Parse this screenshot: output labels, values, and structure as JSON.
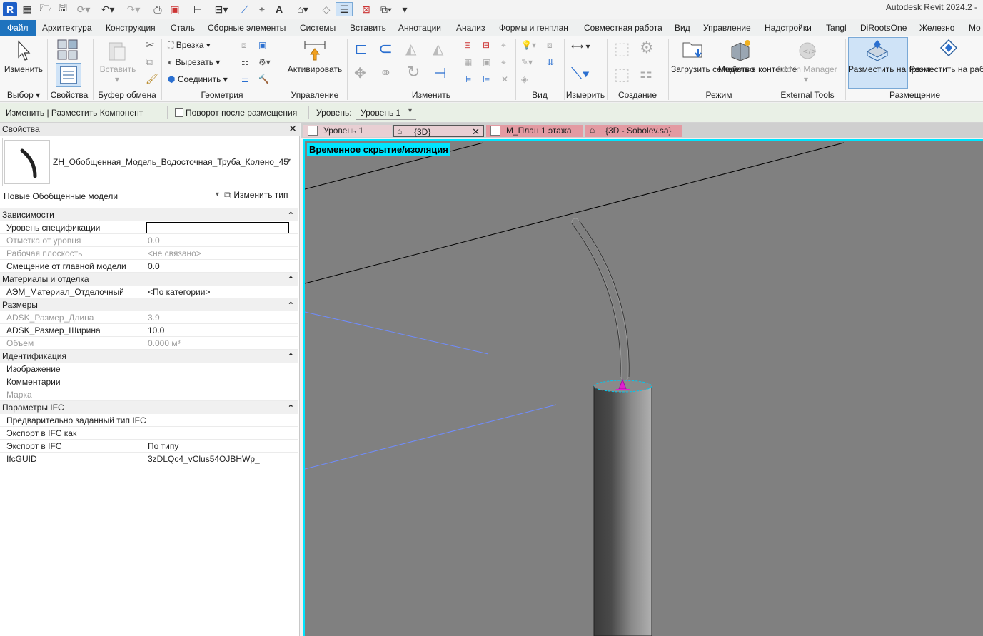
{
  "app": {
    "title": "Autodesk Revit 2024.2 -"
  },
  "menu_tabs": [
    "Файл",
    "Архитектура",
    "Конструкция",
    "Сталь",
    "Сборные элементы",
    "Системы",
    "Вставить",
    "Аннотации",
    "Анализ",
    "Формы и генплан",
    "Совместная работа",
    "Вид",
    "Управление",
    "Надстройки",
    "Tangl",
    "DiRootsOne",
    "Железно",
    "Mo"
  ],
  "ribbon": {
    "modify_label": "Изменить",
    "paste_label": "Вставить",
    "cut_label": "Врезка",
    "cutout_label": "Вырезать",
    "join_label": "Соединить",
    "activate_label": "Активировать",
    "load_family_label": "Загрузить семейство",
    "model_in_context_label": "Модель в контексте",
    "addin_manager_label": "Add-in Manager",
    "place_on_face_label": "Разместить на грани",
    "place_on_plane_label": "Разместить на рабочей плоскост",
    "panels": {
      "select": "Выбор",
      "properties": "Свойства",
      "clipboard": "Буфер обмена",
      "geometry": "Геометрия",
      "control": "Управление",
      "modify": "Изменить",
      "view": "Вид",
      "measure": "Измерить",
      "create": "Создание",
      "mode": "Режим",
      "external_tools": "External Tools",
      "placement": "Размещение"
    }
  },
  "options_bar": {
    "context": "Изменить | Разместить Компонент",
    "rotate_after_place": "Поворот после размещения",
    "level_label": "Уровень:",
    "level_value": "Уровень 1"
  },
  "properties": {
    "title": "Свойства",
    "family_name": "ZH_Обобщенная_Модель_Водосточная_Труба_Колено_45",
    "instance_filter": "Новые Обобщенные модели",
    "edit_type": "Изменить тип",
    "groups": [
      {
        "name": "Зависимости",
        "rows": [
          {
            "name": "Уровень спецификации",
            "value": "",
            "disabled": false,
            "editing": true
          },
          {
            "name": "Отметка от уровня",
            "value": "0.0",
            "disabled": true
          },
          {
            "name": "Рабочая плоскость",
            "value": "<не связано>",
            "disabled": true
          },
          {
            "name": "Смещение от главной модели",
            "value": "0.0",
            "disabled": false
          }
        ]
      },
      {
        "name": "Материалы и отделка",
        "rows": [
          {
            "name": "АЭМ_Материал_Отделочный",
            "value": "<По категории>",
            "disabled": false
          }
        ]
      },
      {
        "name": "Размеры",
        "rows": [
          {
            "name": "ADSK_Размер_Длина",
            "value": "3.9",
            "disabled": true
          },
          {
            "name": "ADSK_Размер_Ширина",
            "value": "10.0",
            "disabled": false
          },
          {
            "name": "Объем",
            "value": "0.000 м³",
            "disabled": true
          }
        ]
      },
      {
        "name": "Идентификация",
        "rows": [
          {
            "name": "Изображение",
            "value": "",
            "disabled": false
          },
          {
            "name": "Комментарии",
            "value": "",
            "disabled": false
          },
          {
            "name": "Марка",
            "value": "",
            "disabled": true
          }
        ]
      },
      {
        "name": "Параметры IFC",
        "rows": [
          {
            "name": "Предварительно заданный тип IFC",
            "value": "",
            "disabled": false
          },
          {
            "name": "Экспорт в IFC как",
            "value": "",
            "disabled": false
          },
          {
            "name": "Экспорт в IFC",
            "value": "По типу",
            "disabled": false
          },
          {
            "name": "IfcGUID",
            "value": "3zDLQc4_vClus54OJBHWp_",
            "disabled": false
          }
        ]
      }
    ]
  },
  "view_tabs": [
    {
      "label": "Уровень 1",
      "color": "#e8cfd3",
      "active": false
    },
    {
      "label": "{3D}",
      "color": "#e8cfd3",
      "active": true
    },
    {
      "label": "М_План 1 этажа",
      "color": "#e39aa2",
      "active": false
    },
    {
      "label": "{3D - Sobolev.sa}",
      "color": "#e39aa2",
      "active": false
    }
  ],
  "viewport": {
    "isolation_label": "Временное скрытие/изоляция"
  },
  "colors": {
    "accent": "#1e73be",
    "isolation_border": "#00e5ff",
    "viewport_bg": "#808080",
    "selection_magenta": "#e020d0"
  }
}
